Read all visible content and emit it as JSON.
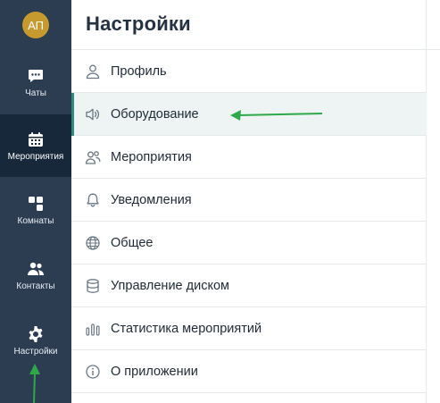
{
  "user": {
    "initials": "АП"
  },
  "sidebar": {
    "items": [
      {
        "label": "Чаты",
        "icon": "chat-icon"
      },
      {
        "label": "Мероприятия",
        "icon": "calendar-icon",
        "active": true
      },
      {
        "label": "Комнаты",
        "icon": "rooms-icon"
      },
      {
        "label": "Контакты",
        "icon": "contacts-icon"
      },
      {
        "label": "Настройки",
        "icon": "gear-icon"
      }
    ]
  },
  "settings": {
    "title": "Настройки",
    "items": [
      {
        "label": "Профиль",
        "icon": "user-icon"
      },
      {
        "label": "Оборудование",
        "icon": "speaker-icon",
        "selected": true
      },
      {
        "label": "Мероприятия",
        "icon": "people-icon"
      },
      {
        "label": "Уведомления",
        "icon": "bell-icon"
      },
      {
        "label": "Общее",
        "icon": "globe-icon"
      },
      {
        "label": "Управление диском",
        "icon": "database-icon"
      },
      {
        "label": "Статистика мероприятий",
        "icon": "stats-icon"
      },
      {
        "label": "О приложении",
        "icon": "info-icon"
      }
    ]
  },
  "colors": {
    "sidebar_bg": "#2c3d52",
    "sidebar_active_bg": "#17283b",
    "avatar_bg": "#c69a2f",
    "selected_accent": "#2e8b7a",
    "annotation_arrow": "#2fa84a"
  }
}
